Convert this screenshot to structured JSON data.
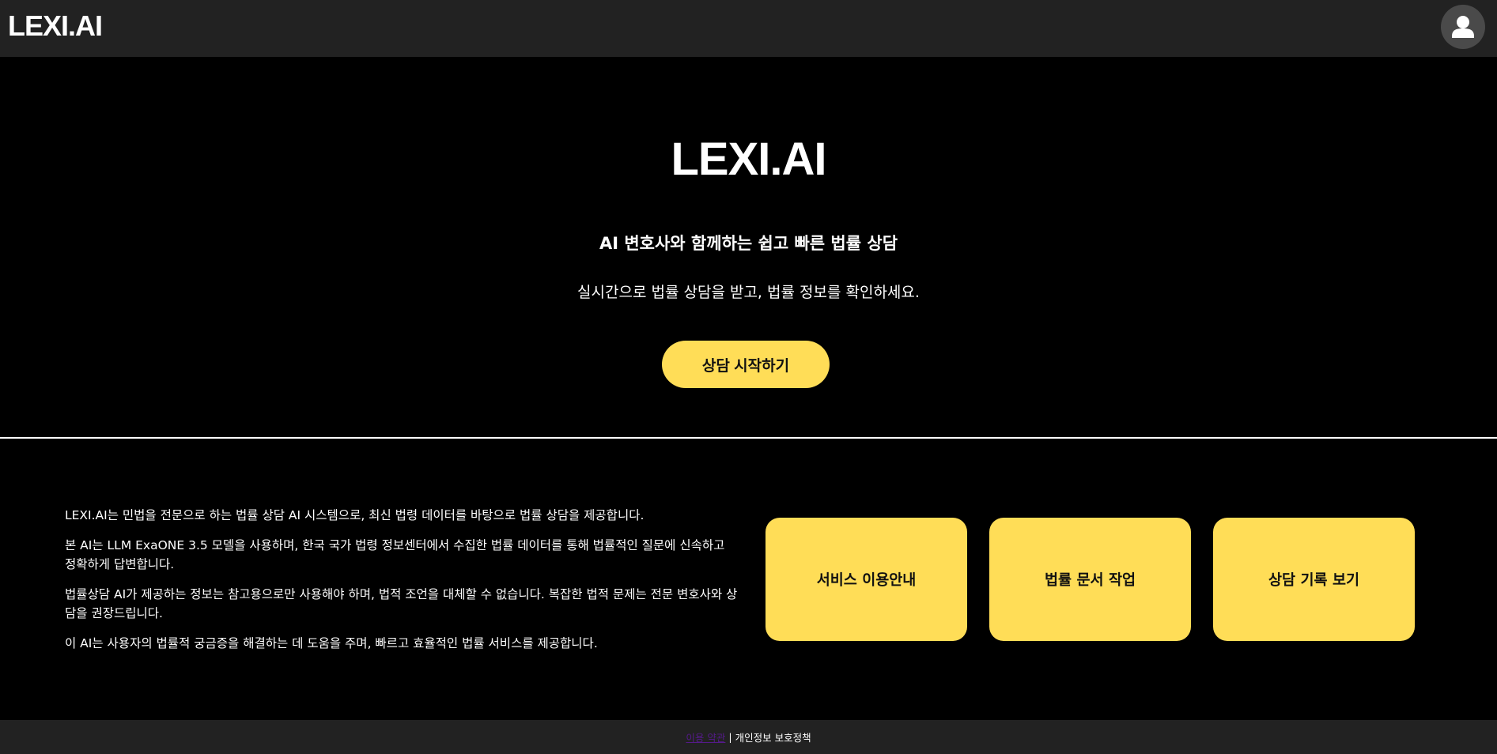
{
  "header": {
    "logo": "LEXI.AI",
    "avatar_icon": "user-icon"
  },
  "hero": {
    "title": "LEXI.AI",
    "subtitle": "AI 변호사와 함께하는 쉽고 빠른 법률 상담",
    "description": "실시간으로 법률 상담을 받고, 법률 정보를 확인하세요.",
    "start_button": "상담 시작하기"
  },
  "info": {
    "paragraphs": [
      "LEXI.AI는 민법을 전문으로 하는 법률 상담 AI 시스템으로, 최신 법령 데이터를 바탕으로 법률 상담을 제공합니다.",
      "본 AI는 LLM ExaONE 3.5 모델을 사용하며, 한국 국가 법령 정보센터에서 수집한 법률 데이터를 통해 법률적인 질문에 신속하고 정확하게 답변합니다.",
      "법률상담 AI가 제공하는 정보는 참고용으로만 사용해야 하며, 법적 조언을 대체할 수 없습니다. 복잡한 법적 문제는 전문 변호사와 상담을 권장드립니다.",
      "이 AI는 사용자의 법률적 궁금증을 해결하는 데 도움을 주며, 빠르고 효율적인 법률 서비스를 제공합니다."
    ]
  },
  "cards": [
    {
      "label": "서비스 이용안내"
    },
    {
      "label": "법률 문서 작업"
    },
    {
      "label": "상담 기록 보기"
    }
  ],
  "footer": {
    "terms_link": "이용 약관",
    "separator": "|",
    "privacy": "개인정보 보호정책"
  },
  "colors": {
    "accent": "#ffdd57",
    "header_bg": "#222222",
    "page_bg": "#000000",
    "visited_link": "#551a8b"
  }
}
